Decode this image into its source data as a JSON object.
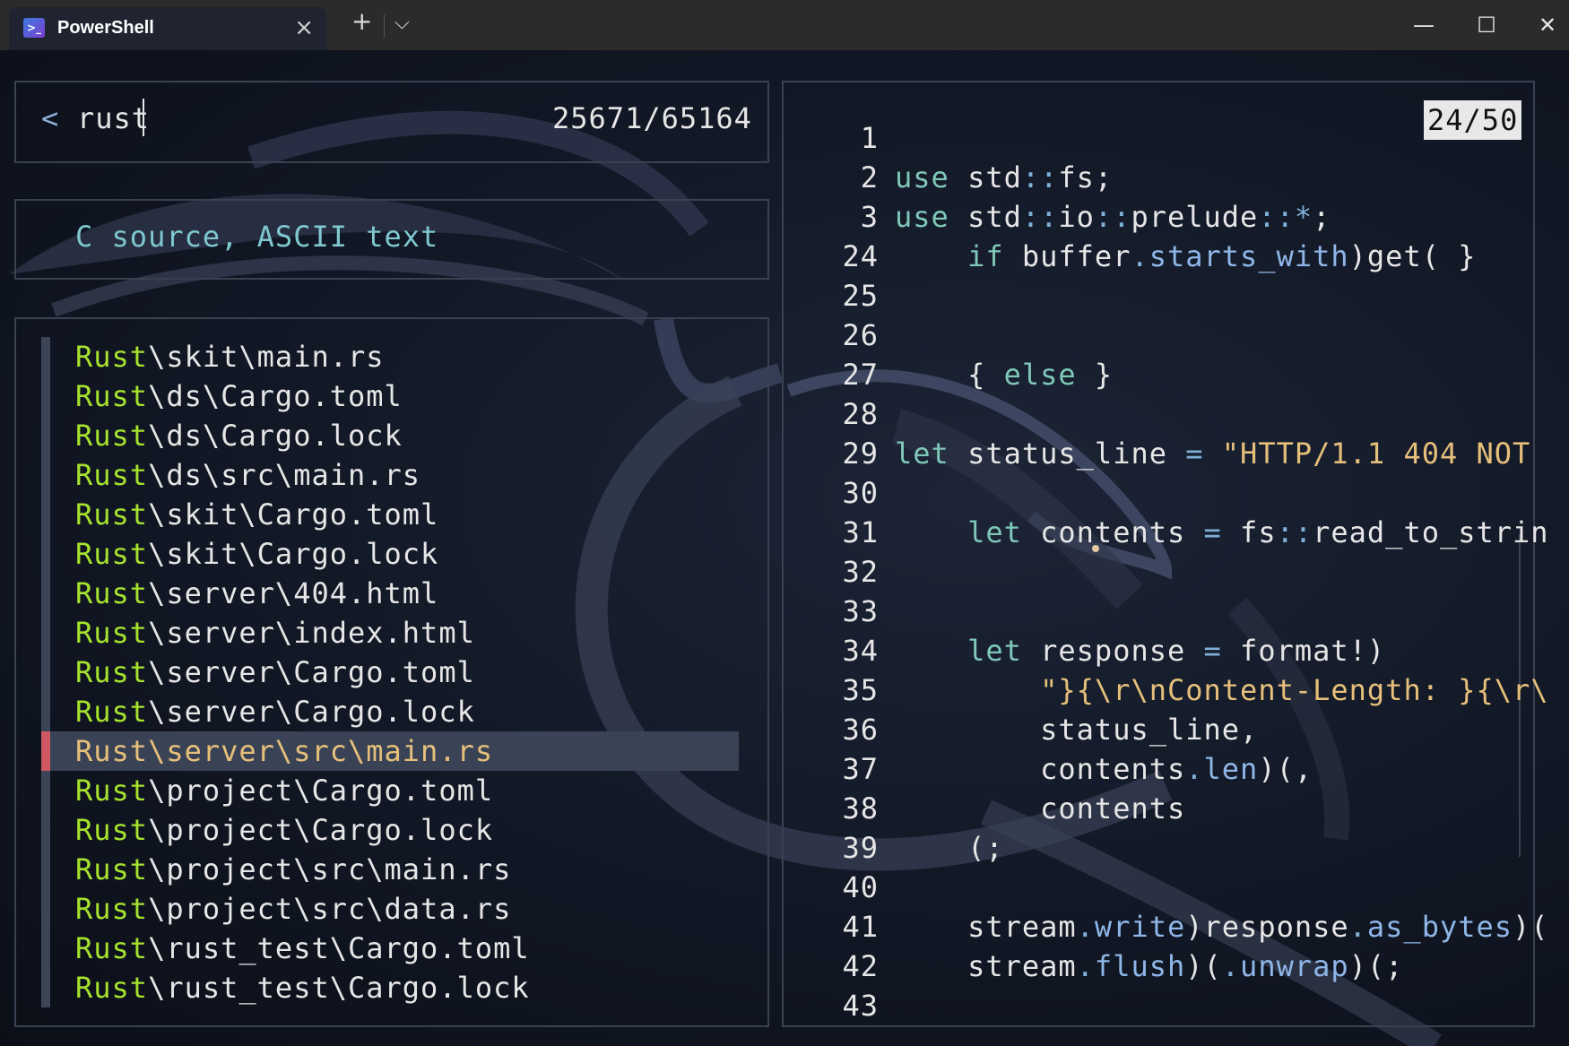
{
  "window": {
    "tab_title": "PowerShell",
    "tab_icon": "powershell-icon",
    "new_tab_symbol": "+",
    "dropdown_symbol": "⌵",
    "close_tab_symbol": "×",
    "minimize_symbol": "—",
    "maximize_symbol": "☐",
    "close_symbol": "✕"
  },
  "search": {
    "prompt": "<",
    "query": "rust",
    "count": "25671/65164"
  },
  "preview_info": {
    "file_type": "C source, ASCII text"
  },
  "files": [
    {
      "prefix": "Rust",
      "rest": "\\skit\\main.rs"
    },
    {
      "prefix": "Rust",
      "rest": "\\ds\\Cargo.toml"
    },
    {
      "prefix": "Rust",
      "rest": "\\ds\\Cargo.lock"
    },
    {
      "prefix": "Rust",
      "rest": "\\ds\\src\\main.rs"
    },
    {
      "prefix": "Rust",
      "rest": "\\skit\\Cargo.toml"
    },
    {
      "prefix": "Rust",
      "rest": "\\skit\\Cargo.lock"
    },
    {
      "prefix": "Rust",
      "rest": "\\server\\404.html"
    },
    {
      "prefix": "Rust",
      "rest": "\\server\\index.html"
    },
    {
      "prefix": "Rust",
      "rest": "\\server\\Cargo.toml"
    },
    {
      "prefix": "Rust",
      "rest": "\\server\\Cargo.lock"
    },
    {
      "prefix": "Rust",
      "rest": "\\server\\src\\main.rs",
      "selected": true
    },
    {
      "prefix": "Rust",
      "rest": "\\project\\Cargo.toml"
    },
    {
      "prefix": "Rust",
      "rest": "\\project\\Cargo.lock"
    },
    {
      "prefix": "Rust",
      "rest": "\\project\\src\\main.rs"
    },
    {
      "prefix": "Rust",
      "rest": "\\project\\src\\data.rs"
    },
    {
      "prefix": "Rust",
      "rest": "\\rust_test\\Cargo.toml"
    },
    {
      "prefix": "Rust",
      "rest": "\\rust_test\\Cargo.lock"
    }
  ],
  "preview": {
    "position": "24/50",
    "lines": [
      {
        "n": "1",
        "segs": []
      },
      {
        "n": "2",
        "segs": [
          [
            "kw",
            "use"
          ],
          [
            "",
            " std"
          ],
          [
            "op",
            "::"
          ],
          [
            "",
            "fs;"
          ]
        ]
      },
      {
        "n": "3",
        "segs": [
          [
            "kw",
            "use"
          ],
          [
            "",
            " std"
          ],
          [
            "op",
            "::"
          ],
          [
            "",
            "io"
          ],
          [
            "op",
            "::"
          ],
          [
            "",
            "prelude"
          ],
          [
            "op",
            "::*"
          ],
          [
            "",
            ";"
          ]
        ]
      },
      {
        "n": "24",
        "segs": [
          [
            "",
            "    "
          ],
          [
            "kw",
            "if"
          ],
          [
            "",
            " buffer"
          ],
          [
            "op",
            "."
          ],
          [
            "fn",
            "starts_with"
          ],
          [
            "",
            ")get( }"
          ]
        ]
      },
      {
        "n": "25",
        "segs": []
      },
      {
        "n": "26",
        "segs": []
      },
      {
        "n": "27",
        "segs": [
          [
            "",
            "    { "
          ],
          [
            "kw",
            "else"
          ],
          [
            "",
            " }"
          ]
        ]
      },
      {
        "n": "28",
        "segs": []
      },
      {
        "n": "29",
        "segs": [
          [
            "kw",
            "let"
          ],
          [
            "",
            " status_line "
          ],
          [
            "op",
            "="
          ],
          [
            "str",
            " \"HTTP/1.1 404 NOT"
          ]
        ]
      },
      {
        "n": "30",
        "segs": []
      },
      {
        "n": "31",
        "segs": [
          [
            "",
            "    "
          ],
          [
            "kw",
            "let"
          ],
          [
            "",
            " contents "
          ],
          [
            "op",
            "="
          ],
          [
            "",
            " fs"
          ],
          [
            "op",
            "::"
          ],
          [
            "",
            "read_to_strin"
          ]
        ]
      },
      {
        "n": "32",
        "segs": []
      },
      {
        "n": "33",
        "segs": []
      },
      {
        "n": "34",
        "segs": [
          [
            "",
            "    "
          ],
          [
            "kw",
            "let"
          ],
          [
            "",
            " response "
          ],
          [
            "op",
            "="
          ],
          [
            "",
            " format!)"
          ]
        ]
      },
      {
        "n": "35",
        "segs": [
          [
            "",
            "        "
          ],
          [
            "str",
            "\"}{\\r\\nContent-Length: }{\\r\\"
          ]
        ]
      },
      {
        "n": "36",
        "segs": [
          [
            "",
            "        status_line,"
          ]
        ]
      },
      {
        "n": "37",
        "segs": [
          [
            "",
            "        contents"
          ],
          [
            "op",
            "."
          ],
          [
            "fn",
            "len"
          ],
          [
            "",
            ")(,"
          ]
        ]
      },
      {
        "n": "38",
        "segs": [
          [
            "",
            "        contents"
          ]
        ]
      },
      {
        "n": "39",
        "segs": [
          [
            "",
            "    (;"
          ]
        ]
      },
      {
        "n": "40",
        "segs": []
      },
      {
        "n": "41",
        "segs": [
          [
            "",
            "    stream"
          ],
          [
            "op",
            "."
          ],
          [
            "fn",
            "write"
          ],
          [
            "",
            ")response"
          ],
          [
            "op",
            "."
          ],
          [
            "fn",
            "as_bytes"
          ],
          [
            "",
            ")("
          ]
        ]
      },
      {
        "n": "42",
        "segs": [
          [
            "",
            "    stream"
          ],
          [
            "op",
            "."
          ],
          [
            "fn",
            "flush"
          ],
          [
            "",
            ")("
          ],
          [
            "op",
            "."
          ],
          [
            "fn",
            "unwrap"
          ],
          [
            "",
            ")(;"
          ]
        ]
      },
      {
        "n": "43",
        "segs": []
      }
    ]
  }
}
